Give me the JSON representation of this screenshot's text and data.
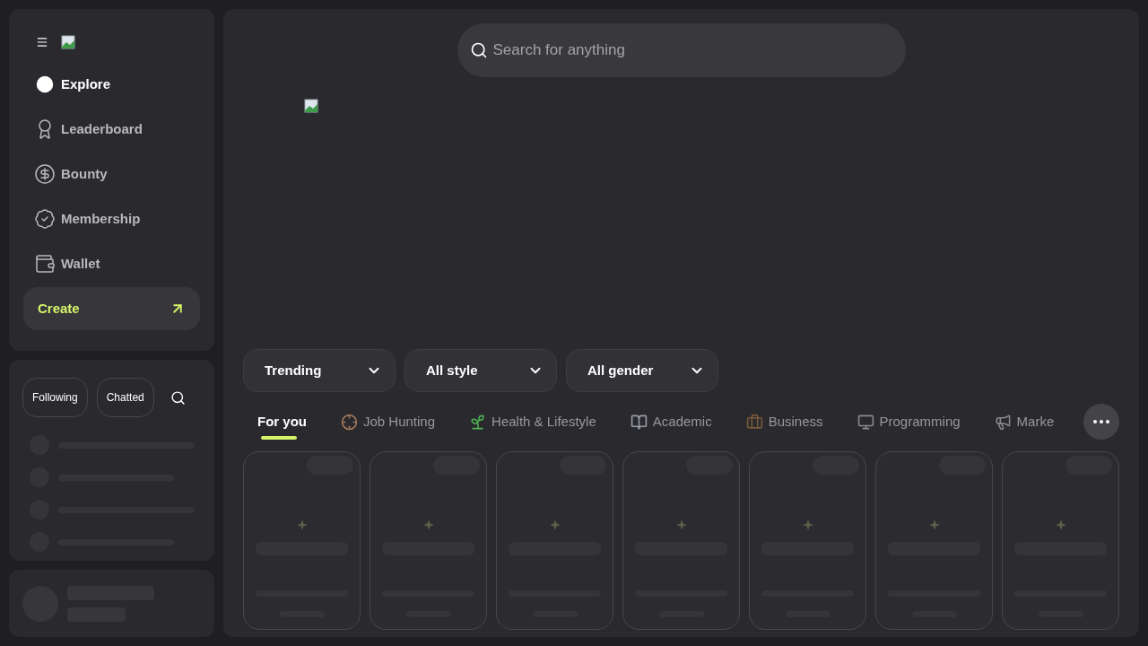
{
  "sidebar": {
    "nav": [
      {
        "label": "Explore",
        "selected": true
      },
      {
        "label": "Leaderboard",
        "selected": false
      },
      {
        "label": "Bounty",
        "selected": false
      },
      {
        "label": "Membership",
        "selected": false
      },
      {
        "label": "Wallet",
        "selected": false
      }
    ],
    "create_button": "Create",
    "chips": [
      {
        "label": "Following",
        "selected": false
      },
      {
        "label": "Chatted",
        "selected": false
      }
    ]
  },
  "search": {
    "placeholder": "Search for anything"
  },
  "filters": [
    {
      "label": "Trending"
    },
    {
      "label": "All style"
    },
    {
      "label": "All gender"
    }
  ],
  "categories": [
    {
      "label": "For you",
      "selected": true
    },
    {
      "label": "Job Hunting",
      "selected": false
    },
    {
      "label": "Health & Lifestyle",
      "selected": false
    },
    {
      "label": "Academic",
      "selected": false
    },
    {
      "label": "Business",
      "selected": false
    },
    {
      "label": "Programming",
      "selected": false
    },
    {
      "label": "Marke",
      "selected": false
    }
  ]
}
